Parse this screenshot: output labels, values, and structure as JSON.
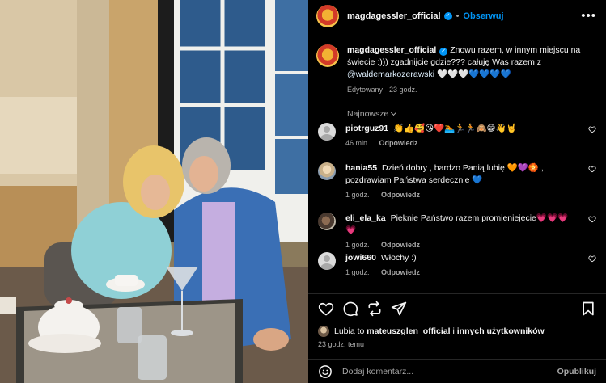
{
  "post": {
    "username": "magdagessler_official",
    "follow_label": "Obserwuj",
    "more_icon": "more-horizontal-icon",
    "caption_text": "Znowu razem, w innym miejscu na świecie :))) zgadnijcie gdzie??? całuję Was razem z",
    "caption_mention": "@waldemarkozerawski",
    "caption_emoji": "🤍🤍🤍💙💙💙💙",
    "edited_meta": "Edytowany · 23 godz.",
    "sort_label": "Najnowsze"
  },
  "comments": [
    {
      "username": "piotrguz91",
      "text": "👏👍🥰😘❤️🏊🏃🏃🙈😁👋🤘",
      "time": "46 min",
      "reply_label": "Odpowiedz"
    },
    {
      "username": "hania55",
      "text": "Dzień dobry , bardzo Panią lubię 🧡💜🏵️ , pozdrawiam Państwa serdecznie 💙",
      "time": "1 godz.",
      "reply_label": "Odpowiedz"
    },
    {
      "username": "eli_ela_ka",
      "text": "Pieknie Państwo razem promieniejecie💗💗💗💗",
      "time": "1 godz.",
      "reply_label": "Odpowiedz"
    },
    {
      "username": "jowi660",
      "text": "Włochy :)",
      "time": "1 godz.",
      "reply_label": "Odpowiedz"
    }
  ],
  "likes": {
    "prefix": "Lubią to",
    "user": "mateuszglen_official",
    "conjunction": "i",
    "others": "innych użytkowników"
  },
  "timestamp": "23 godz. temu",
  "add_comment": {
    "placeholder": "Dodaj komentarz...",
    "publish_label": "Opublikuj"
  },
  "colors": {
    "background": "#000000",
    "accent": "#0095f6",
    "muted": "#a8a8a8",
    "text": "#f5f5f5"
  }
}
